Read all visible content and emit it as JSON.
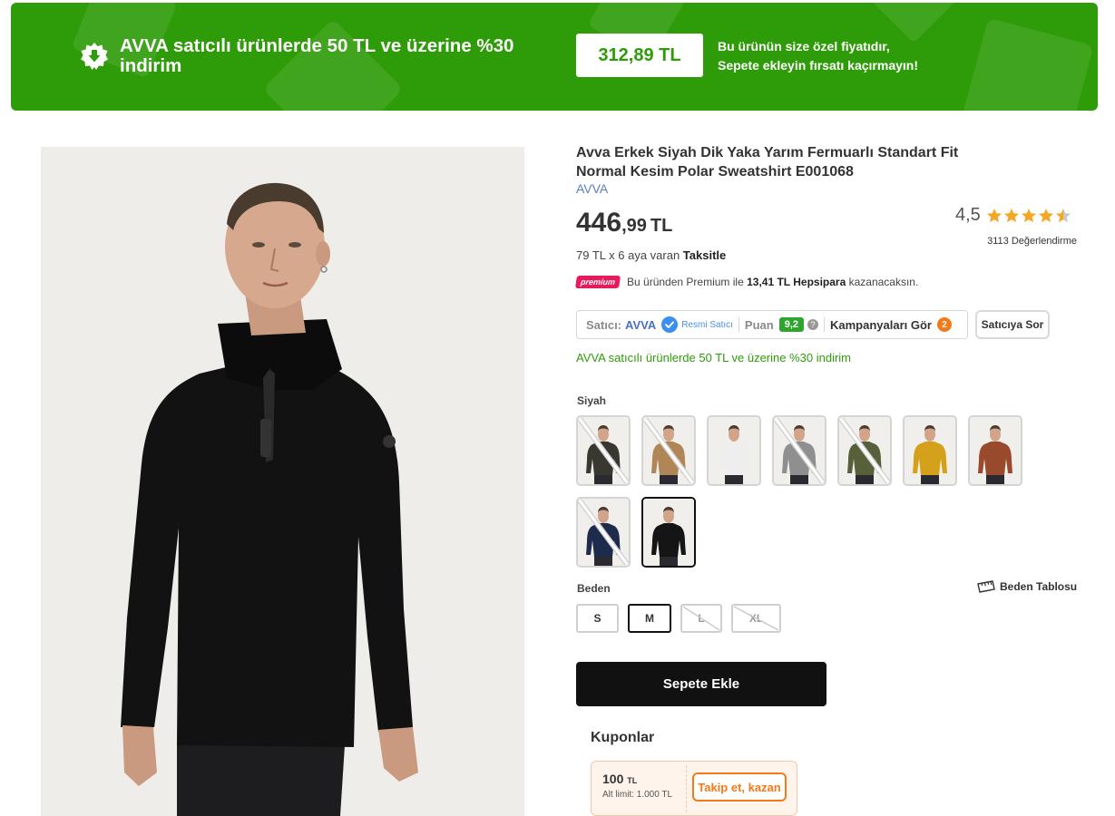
{
  "banner": {
    "title": "AVVA satıcılı ürünlerde 50 TL ve üzerine %30 indirim",
    "special_price": "312,89 TL",
    "note_line1": "Bu ürünün size özel fiyatıdır,",
    "note_line2": "Sepete ekleyin fırsatı kaçırmayın!",
    "icon": "discount-badge-icon",
    "color": "#2e9c08"
  },
  "product": {
    "title": "Avva Erkek Siyah Dik Yaka Yarım Fermuarlı Standart Fit Normal Kesim Polar Sweatshirt E001068",
    "brand": "AVVA",
    "price_main": "446",
    "price_decimal": ",99",
    "price_currency": "TL",
    "installment_text": "79 TL x 6 aya varan ",
    "installment_bold": "Taksitle",
    "rating_value": "4,5",
    "rating": 4.5,
    "rating_max": 5,
    "reviews": "3113 Değerlendirme"
  },
  "premium": {
    "badge": "premium",
    "text_before": "Bu üründen Premium ile ",
    "amount": "13,41 TL Hepsipara",
    "text_after": " kazanacaksın."
  },
  "seller": {
    "label": "Satıcı:",
    "name": "AVVA",
    "official": "Resmi Satıcı",
    "score_label": "Puan",
    "score": "9,2",
    "campaigns": "Kampanyaları Gör",
    "campaign_count": "2",
    "ask_button": "Satıcıya Sor"
  },
  "discount_text": "AVVA satıcılı ürünlerde 50 TL ve üzerine %30 indirim",
  "colors": {
    "label": "Siyah",
    "swatches": [
      {
        "name": "dark-brown",
        "sweater": "#3a3630",
        "available": false
      },
      {
        "name": "camel",
        "sweater": "#b08656",
        "available": false
      },
      {
        "name": "white",
        "sweater": "#eeeeee",
        "available": true
      },
      {
        "name": "grey",
        "sweater": "#8f8f8f",
        "available": false
      },
      {
        "name": "khaki",
        "sweater": "#56603a",
        "available": false
      },
      {
        "name": "mustard",
        "sweater": "#d6a11a",
        "available": true
      },
      {
        "name": "rust",
        "sweater": "#9a4a2c",
        "available": true
      },
      {
        "name": "navy",
        "sweater": "#1d2b4c",
        "available": false
      },
      {
        "name": "black",
        "sweater": "#151515",
        "available": true,
        "selected": true
      }
    ]
  },
  "sizes": {
    "label": "Beden",
    "chart_link": "Beden Tablosu",
    "options": [
      {
        "label": "S",
        "available": true
      },
      {
        "label": "M",
        "available": true,
        "selected": true
      },
      {
        "label": "L",
        "available": false
      },
      {
        "label": "XL",
        "available": false
      }
    ]
  },
  "add_to_cart": "Sepete Ekle",
  "coupons": {
    "title": "Kuponlar",
    "amount": "100",
    "currency": "TL",
    "limit": "Alt limit: 1.000 TL",
    "action": "Takip et, kazan"
  }
}
